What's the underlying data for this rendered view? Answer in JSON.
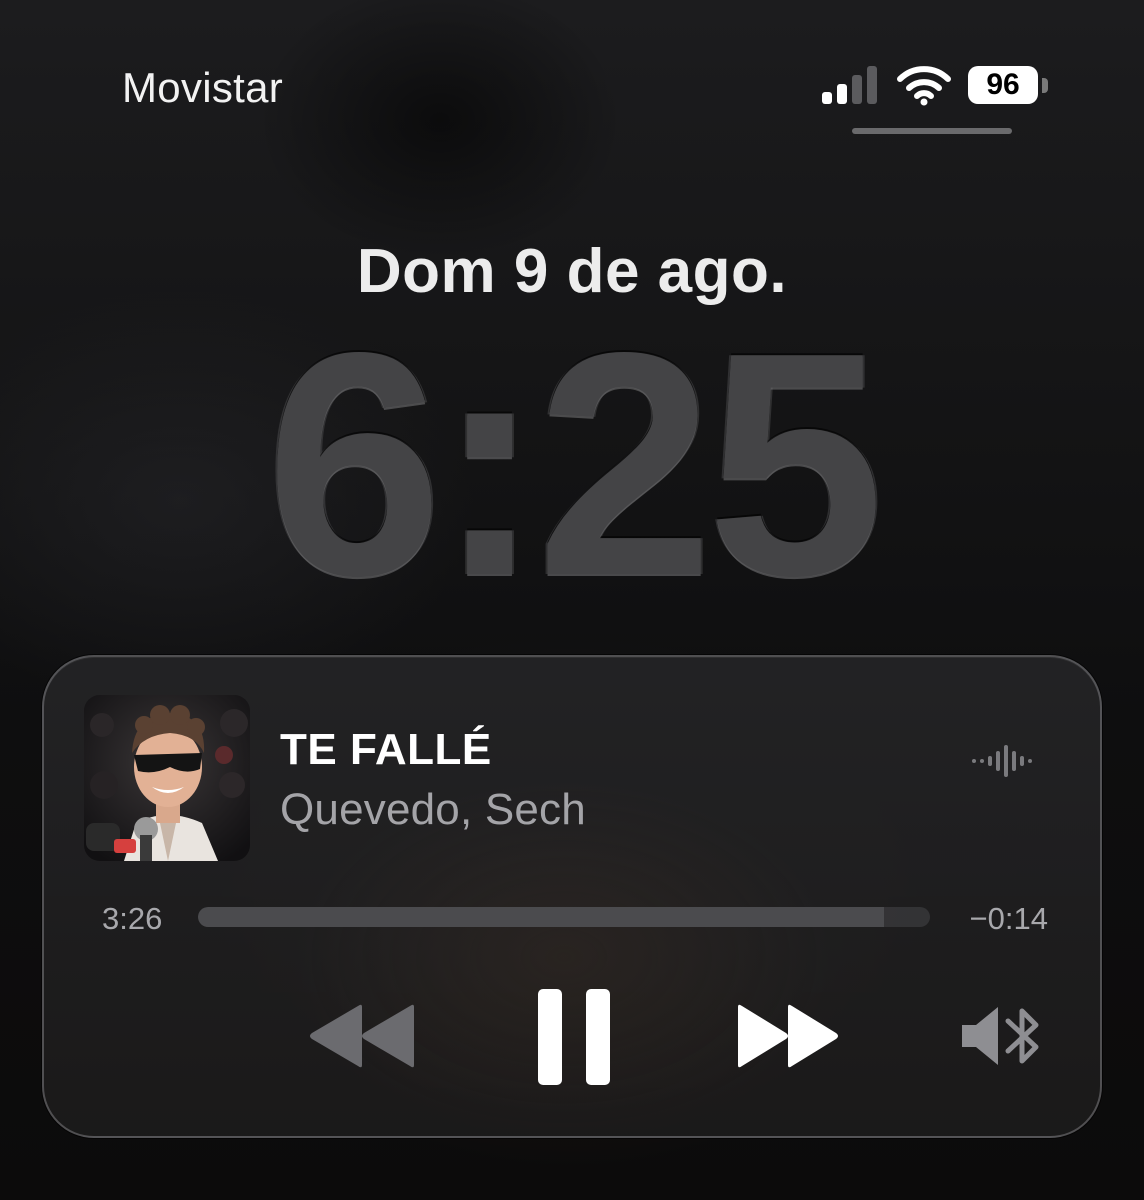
{
  "status_bar": {
    "carrier": "Movistar",
    "battery_level": "96",
    "signal_bars_active": 2,
    "signal_bars_total": 4,
    "icons": [
      "signal-icon",
      "wifi-icon",
      "battery-icon"
    ]
  },
  "lock_screen": {
    "date": "Dom 9 de ago.",
    "time": "6:25"
  },
  "now_playing": {
    "title": "TE FALLÉ",
    "artist": "Quevedo, Sech",
    "elapsed": "3:26",
    "remaining": "−0:14",
    "progress_fraction": 0.937,
    "state": "playing",
    "controls": [
      "rewind-icon",
      "pause-icon",
      "fast-forward-icon",
      "bluetooth-audio-icon"
    ],
    "artwork_icon": "album-artwork",
    "waveform_icon": "audio-waveform-icon"
  },
  "colors": {
    "background": "#141415",
    "clock": "#444446",
    "progress_track": "#2f2f31",
    "progress_fill": "#4b4b4e",
    "primary_text": "#ffffff",
    "secondary_text": "#a4a4a8"
  }
}
